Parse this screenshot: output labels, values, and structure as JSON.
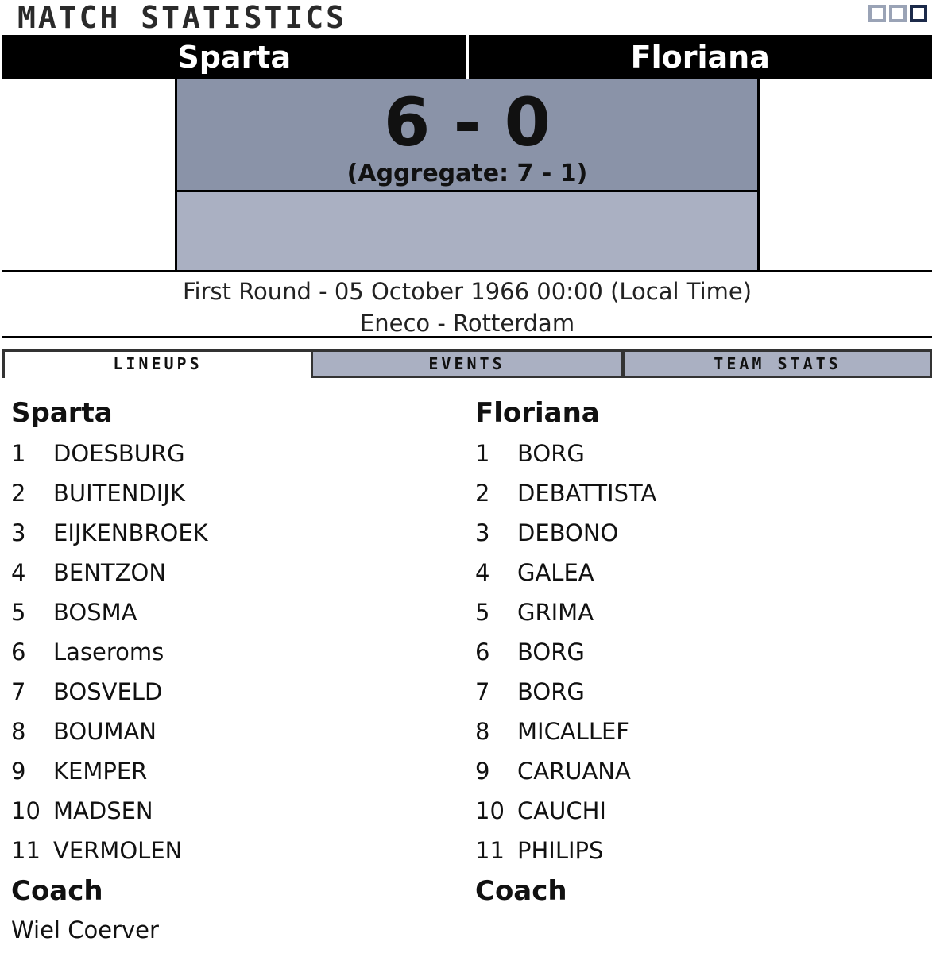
{
  "header": {
    "title": "MATCH STATISTICS"
  },
  "teams": {
    "home": "Sparta",
    "away": "Floriana"
  },
  "score": {
    "main": "6 - 0",
    "aggregate": "(Aggregate: 7 - 1)"
  },
  "info": {
    "round_date": "First Round - 05 October 1966 00:00 (Local Time)",
    "venue": "Eneco - Rotterdam"
  },
  "tabs": [
    {
      "label": "LINEUPS",
      "active": true
    },
    {
      "label": "EVENTS",
      "active": false
    },
    {
      "label": "TEAM STATS",
      "active": false
    }
  ],
  "lineups": {
    "home": {
      "team": "Sparta",
      "players": [
        {
          "num": "1",
          "name": "DOESBURG"
        },
        {
          "num": "2",
          "name": "BUITENDIJK"
        },
        {
          "num": "3",
          "name": "EIJKENBROEK"
        },
        {
          "num": "4",
          "name": "BENTZON"
        },
        {
          "num": "5",
          "name": "BOSMA"
        },
        {
          "num": "6",
          "name": "Laseroms"
        },
        {
          "num": "7",
          "name": "BOSVELD"
        },
        {
          "num": "8",
          "name": "BOUMAN"
        },
        {
          "num": "9",
          "name": "KEMPER"
        },
        {
          "num": "10",
          "name": "MADSEN"
        },
        {
          "num": "11",
          "name": "VERMOLEN"
        }
      ],
      "coach_label": "Coach",
      "coach": "Wiel Coerver"
    },
    "away": {
      "team": "Floriana",
      "players": [
        {
          "num": "1",
          "name": "BORG"
        },
        {
          "num": "2",
          "name": "DEBATTISTA"
        },
        {
          "num": "3",
          "name": "DEBONO"
        },
        {
          "num": "4",
          "name": "GALEA"
        },
        {
          "num": "5",
          "name": "GRIMA"
        },
        {
          "num": "6",
          "name": "BORG"
        },
        {
          "num": "7",
          "name": "BORG"
        },
        {
          "num": "8",
          "name": "MICALLEF"
        },
        {
          "num": "9",
          "name": "CARUANA"
        },
        {
          "num": "10",
          "name": "CAUCHI"
        },
        {
          "num": "11",
          "name": "PHILIPS"
        }
      ],
      "coach_label": "Coach",
      "coach": ""
    }
  },
  "colors": {
    "score_top": "#8a93a8",
    "score_bottom": "#aab0c2",
    "tab_inactive": "#aab0c2",
    "team_bar": "#000000"
  }
}
